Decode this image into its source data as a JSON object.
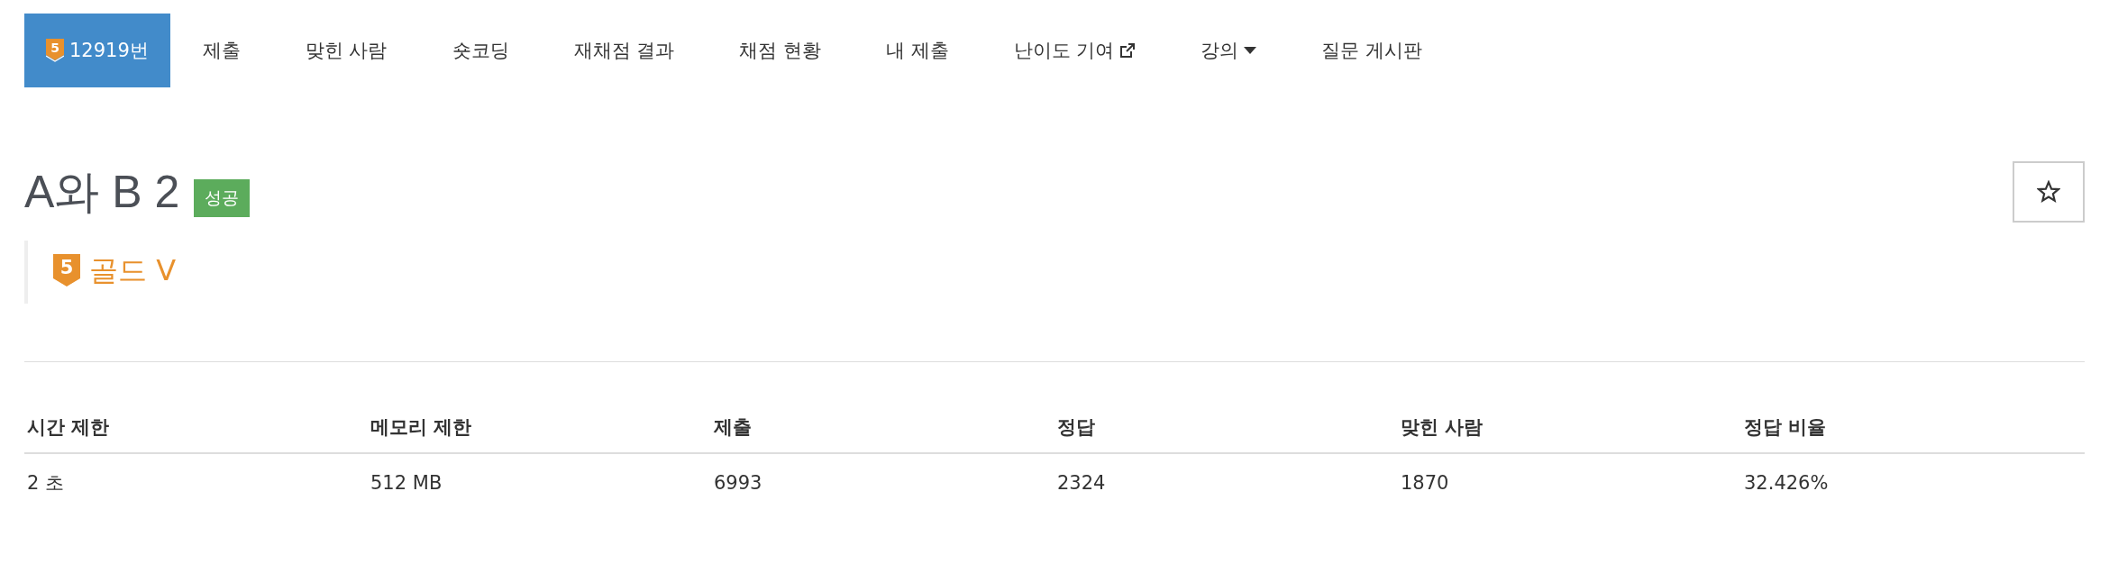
{
  "nav": [
    {
      "label": "12919번",
      "tier": "5",
      "selected": true
    },
    {
      "label": "제출",
      "selected": false
    },
    {
      "label": "맞힌 사람",
      "selected": false
    },
    {
      "label": "숏코딩",
      "selected": false
    },
    {
      "label": "재채점 결과",
      "selected": false
    },
    {
      "label": "채점 현황",
      "selected": false
    },
    {
      "label": "내 제출",
      "selected": false
    },
    {
      "label": "난이도 기여",
      "kind": "external",
      "selected": false
    },
    {
      "label": "강의",
      "kind": "dropdown",
      "selected": false
    },
    {
      "label": "질문 게시판",
      "selected": false
    }
  ],
  "problem": {
    "title": "A와 B 2",
    "status": "성공",
    "tier": {
      "digit": "5",
      "name": "골드 V"
    },
    "starred": false
  },
  "table": {
    "columns": [
      "시간 제한",
      "메모리 제한",
      "제출",
      "정답",
      "맞힌 사람",
      "정답 비율"
    ],
    "rows": [
      [
        "2 초",
        "512 MB",
        "6993",
        "2324",
        "1870",
        "32.426%"
      ]
    ]
  }
}
